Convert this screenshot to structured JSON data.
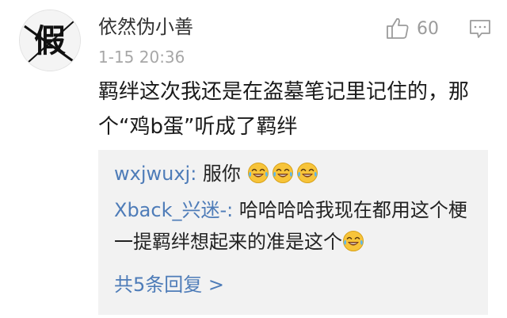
{
  "comment": {
    "avatar_text": "假",
    "username": "依然伪小善",
    "timestamp": "1-15 20:36",
    "like_count": "60",
    "text": "羁绊这次我还是在盗墓笔记里记住的，那个“鸡b蛋”听成了羁绊"
  },
  "replies": [
    {
      "user": "wxjwuxj:",
      "text": " 服你",
      "emoji_count": 3
    },
    {
      "user": "Xback_兴迷-:",
      "text": " 哈哈哈哈我现在都用这个梗 一提羁绊想起来的准是这个",
      "emoji_count": 1
    }
  ],
  "more_replies": {
    "label": "共5条回复",
    "arrow": ">"
  },
  "icons": {
    "like": "thumbs-up-icon",
    "reply": "comment-bubble-icon",
    "emoji": "laughing-crying-emoji-icon"
  }
}
